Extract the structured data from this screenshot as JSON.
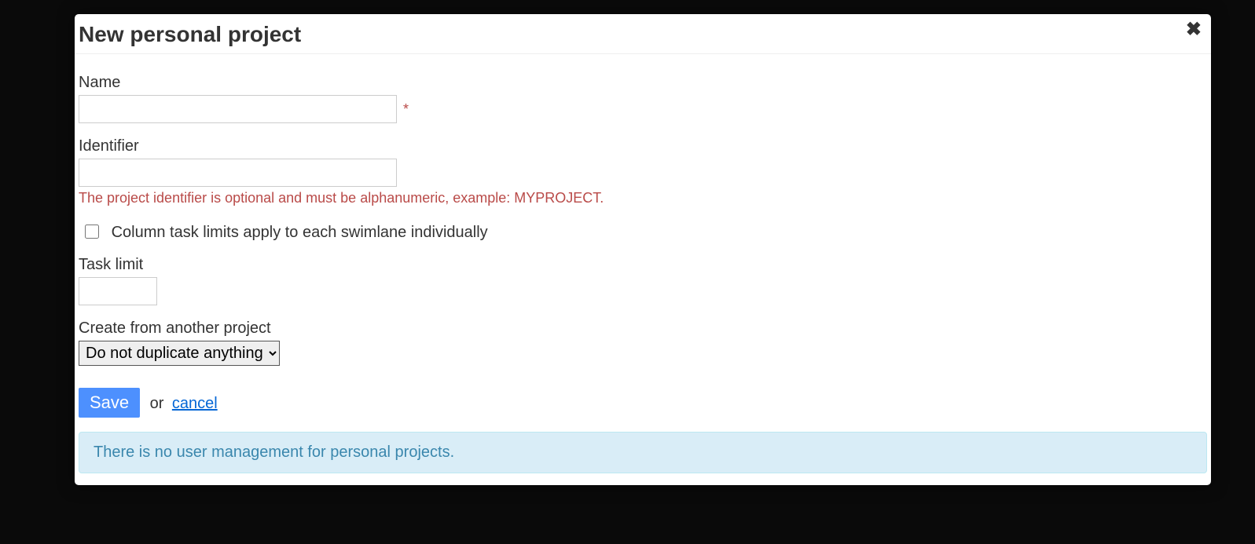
{
  "modal": {
    "title": "New personal project",
    "fields": {
      "name": {
        "label": "Name",
        "value": "",
        "required_mark": "*"
      },
      "identifier": {
        "label": "Identifier",
        "value": "",
        "hint": "The project identifier is optional and must be alphanumeric, example: MYPROJECT."
      },
      "swimlane_checkbox": {
        "label": "Column task limits apply to each swimlane individually",
        "checked": false
      },
      "task_limit": {
        "label": "Task limit",
        "value": ""
      },
      "create_from": {
        "label": "Create from another project",
        "selected": "Do not duplicate anything"
      }
    },
    "actions": {
      "save": "Save",
      "or": "or",
      "cancel": "cancel"
    },
    "info": "There is no user management for personal projects."
  }
}
